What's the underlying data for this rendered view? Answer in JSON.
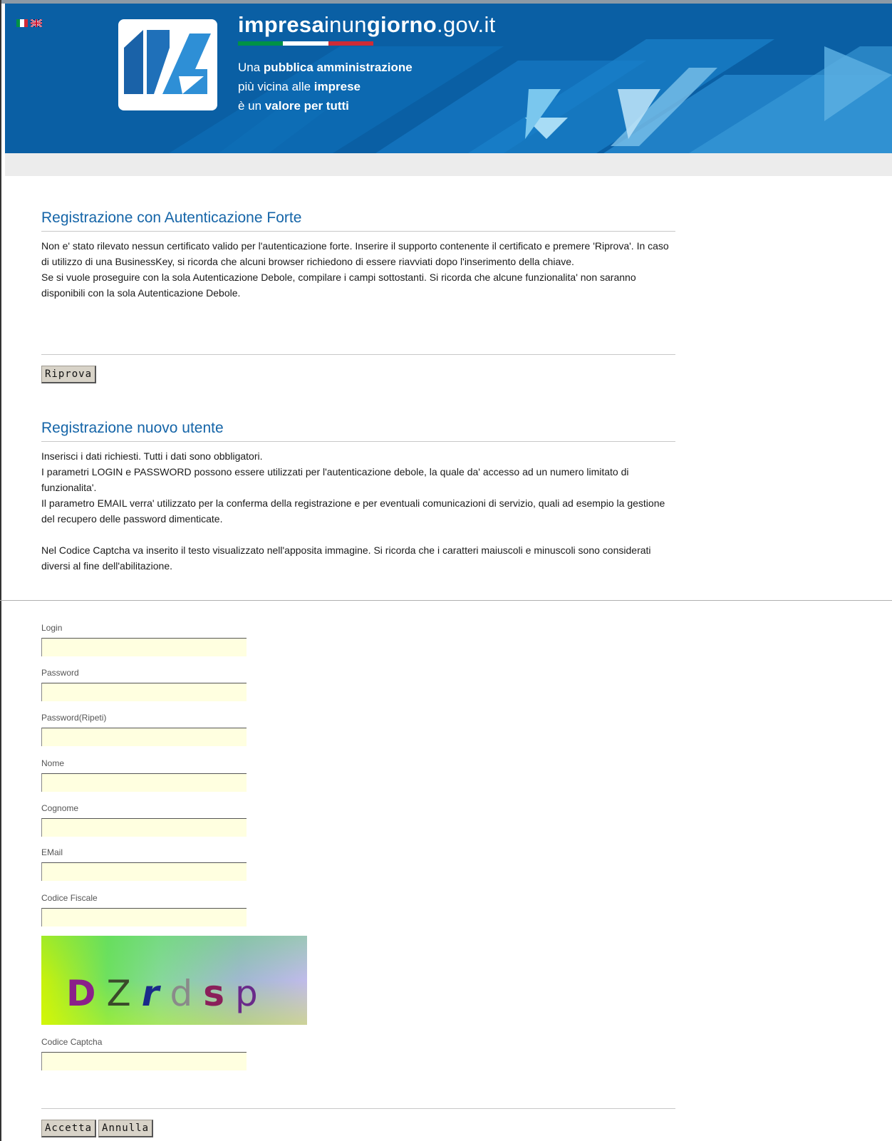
{
  "header": {
    "site_title_part1": "impresa",
    "site_title_part2": "inun",
    "site_title_part3": "giorno",
    "site_title_part4": ".gov.it",
    "tagline_line1_a": "Una ",
    "tagline_line1_b": "pubblica amministrazione",
    "tagline_line2_a": "più vicina alle ",
    "tagline_line2_b": "imprese",
    "tagline_line3_a": "è un ",
    "tagline_line3_b": "valore per tutti",
    "flags": [
      "italian-flag-icon",
      "uk-flag-icon"
    ],
    "colors": {
      "brand_blue": "#0b64a8",
      "heading_blue": "#1565a8"
    }
  },
  "strong_auth": {
    "title": "Registrazione con Autenticazione Forte",
    "paragraph1": "Non e' stato rilevato nessun certificato valido per l'autenticazione forte. Inserire il supporto contenente il certificato e premere 'Riprova'. In caso di utilizzo di una BusinessKey, si ricorda che alcuni browser richiedono di essere riavviati dopo l'inserimento della chiave.",
    "paragraph2": "Se si vuole proseguire con la sola Autenticazione Debole, compilare i campi sottostanti. Si ricorda che alcune funzionalita' non saranno disponibili con la sola Autenticazione Debole.",
    "retry_button": "Riprova"
  },
  "new_user": {
    "title": "Registrazione nuovo utente",
    "line1": "Inserisci i dati richiesti. Tutti i dati sono obbligatori.",
    "line2": "I parametri LOGIN e PASSWORD possono essere utilizzati per l'autenticazione debole, la quale da' accesso ad un numero limitato di funzionalita'.",
    "line3": "Il parametro EMAIL verra' utilizzato per la conferma della registrazione e per eventuali comunicazioni di servizio, quali ad esempio la gestione del recupero delle password dimenticate.",
    "line4": "Nel Codice Captcha va inserito il testo visualizzato nell'apposita immagine. Si ricorda che i caratteri maiuscoli e minuscoli sono considerati diversi al fine dell'abilitazione."
  },
  "form": {
    "login_label": "Login",
    "login_value": "",
    "password_label": "Password",
    "password_value": "",
    "password_repeat_label": "Password(Ripeti)",
    "password_repeat_value": "",
    "nome_label": "Nome",
    "nome_value": "",
    "cognome_label": "Cognome",
    "cognome_value": "",
    "email_label": "EMail",
    "email_value": "",
    "codice_fiscale_label": "Codice Fiscale",
    "codice_fiscale_value": "",
    "captcha_chars": [
      {
        "char": "D",
        "color": "#8a1f8a"
      },
      {
        "char": "Z",
        "color": "#3a4a2a"
      },
      {
        "char": "r",
        "color": "#1a2a8a"
      },
      {
        "char": "d",
        "color": "#8a8a8a"
      },
      {
        "char": "s",
        "color": "#8a1f5a"
      },
      {
        "char": "p",
        "color": "#6a2a8a"
      }
    ],
    "captcha_label": "Codice Captcha",
    "captcha_value": "",
    "accept_button": "Accetta",
    "cancel_button": "Annulla"
  }
}
